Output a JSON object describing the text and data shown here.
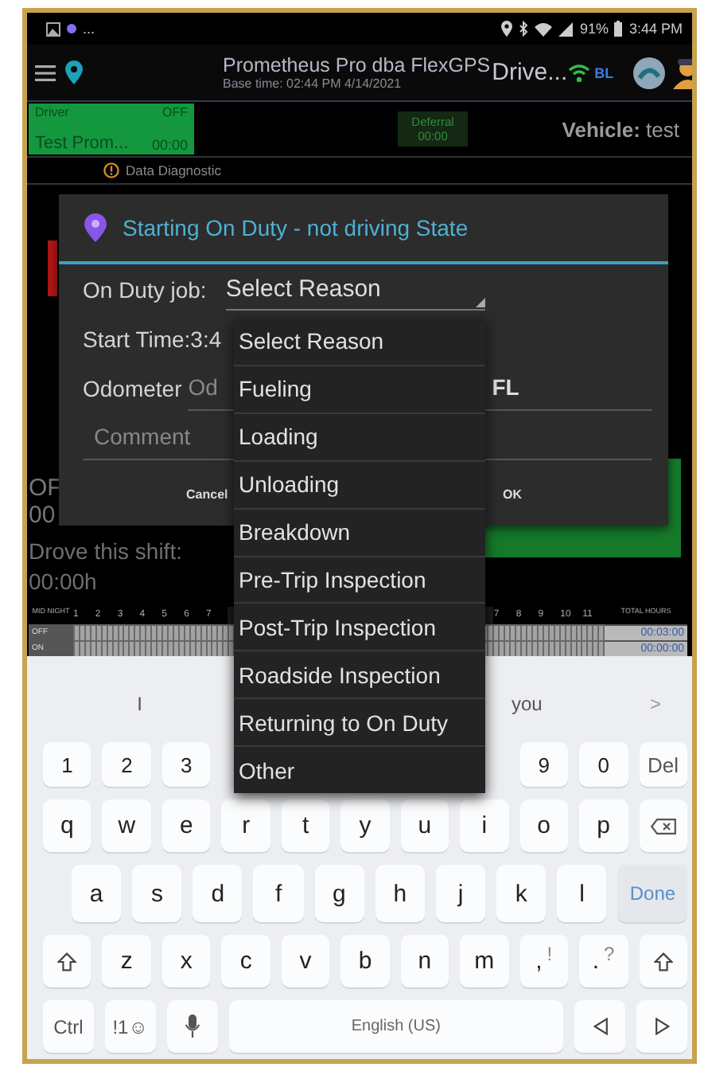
{
  "status_bar": {
    "more": "...",
    "battery": "91%",
    "time": "3:44 PM"
  },
  "app_bar": {
    "title": "Prometheus Pro dba FlexGPS",
    "subtitle": "Base time: 02:44 PM 4/14/2021",
    "driver_label": "Drive...",
    "connection": "BL"
  },
  "driver_panel": {
    "label": "Driver",
    "status": "OFF",
    "name": "Test Prom...",
    "time": "00:00"
  },
  "deferral": {
    "label": "Deferral",
    "time": "00:00"
  },
  "vehicle": "**Vehicle:** test",
  "diagnostic": "Data Diagnostic",
  "background": {
    "status_code": "OF",
    "status_time": "00",
    "drove_label": "Drove this shift:",
    "drove_time": "00:00h"
  },
  "log_grid": {
    "corner": "MID NIGHT",
    "hours_am": [
      "1",
      "2",
      "3",
      "4",
      "5",
      "6",
      "7"
    ],
    "hours_pm": [
      "7",
      "8",
      "9",
      "10",
      "11"
    ],
    "total_label": "TOTAL HOURS",
    "rows": [
      {
        "label": "OFF",
        "total": "00:03:00"
      },
      {
        "label": "ON",
        "total": "00:00:00"
      }
    ]
  },
  "dialog": {
    "title": "Starting On Duty - not driving State",
    "job_label": "On Duty job:",
    "job_value": "Select Reason",
    "start_time": "Start Time:3:4",
    "odometer_label": "Odometer",
    "odometer_placeholder": "Od",
    "odometer_unit": "FL",
    "comment_placeholder": "Comment",
    "buttons": [
      "Cancel",
      "OK"
    ]
  },
  "dropdown": {
    "items": [
      "Select Reason",
      "Fueling",
      "Loading",
      "Unloading",
      "Breakdown",
      "Pre-Trip Inspection",
      "Post-Trip Inspection",
      "Roadside Inspection",
      "Returning to On Duty",
      "Other"
    ]
  },
  "keyboard": {
    "suggestions": [
      "I",
      "you"
    ],
    "suggest_more": ">",
    "number_row": [
      {
        "kind": "char",
        "label": "1"
      },
      {
        "kind": "char",
        "label": "2"
      },
      {
        "kind": "char",
        "label": "3"
      },
      {
        "kind": "covered"
      },
      {
        "kind": "covered"
      },
      {
        "kind": "covered"
      },
      {
        "kind": "covered"
      },
      {
        "kind": "covered"
      },
      {
        "kind": "char",
        "label": "9"
      },
      {
        "kind": "char",
        "label": "0"
      },
      {
        "kind": "action",
        "label": "Del"
      }
    ],
    "top_letter_row": [
      {
        "kind": "char",
        "label": "q"
      },
      {
        "kind": "char",
        "label": "w"
      },
      {
        "kind": "char",
        "label": "e"
      },
      {
        "kind": "char",
        "label": "r"
      },
      {
        "kind": "char",
        "label": "t"
      },
      {
        "kind": "char",
        "label": "y"
      },
      {
        "kind": "char",
        "label": "u"
      },
      {
        "kind": "char",
        "label": "i"
      },
      {
        "kind": "char",
        "label": "o"
      },
      {
        "kind": "char",
        "label": "p"
      },
      {
        "kind": "backspace"
      }
    ],
    "home_letter_row": [
      {
        "kind": "char",
        "label": "a"
      },
      {
        "kind": "char",
        "label": "s"
      },
      {
        "kind": "char",
        "label": "d"
      },
      {
        "kind": "char",
        "label": "f"
      },
      {
        "kind": "char",
        "label": "g"
      },
      {
        "kind": "char",
        "label": "h"
      },
      {
        "kind": "char",
        "label": "j"
      },
      {
        "kind": "char",
        "label": "k"
      },
      {
        "kind": "char",
        "label": "l"
      },
      {
        "kind": "done",
        "label": "Done"
      }
    ],
    "bottom_letter_row": [
      {
        "kind": "shift"
      },
      {
        "kind": "char",
        "label": "z"
      },
      {
        "kind": "char",
        "label": "x"
      },
      {
        "kind": "char",
        "label": "c"
      },
      {
        "kind": "char",
        "label": "v"
      },
      {
        "kind": "char",
        "label": "b"
      },
      {
        "kind": "char",
        "label": "n"
      },
      {
        "kind": "char",
        "label": "m"
      },
      {
        "kind": "char",
        "label": ",",
        "hint": "!"
      },
      {
        "kind": "char",
        "label": ".",
        "hint": "?"
      },
      {
        "kind": "shift"
      }
    ],
    "function_row": [
      {
        "kind": "action",
        "label": "Ctrl"
      },
      {
        "kind": "action",
        "label": "!1☺"
      },
      {
        "kind": "mic"
      },
      {
        "kind": "space",
        "label": "English (US)"
      },
      {
        "kind": "left"
      },
      {
        "kind": "right"
      }
    ]
  }
}
